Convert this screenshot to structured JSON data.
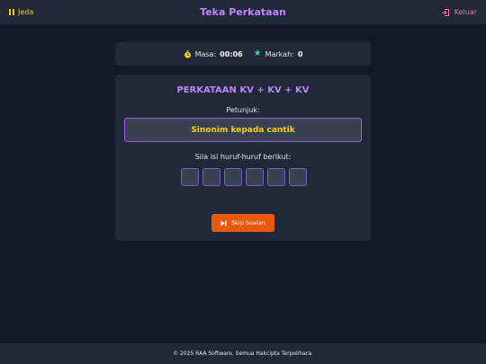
{
  "header": {
    "pause_label": "Jeda",
    "title": "Teka Perkataan",
    "exit_label": "Keluar"
  },
  "stats": {
    "time_label": "Masa:",
    "time_value": "00:06",
    "score_label": "Markah:",
    "score_value": "0"
  },
  "game": {
    "pattern": "PERKATAAN KV + KV + KV",
    "hint_label": "Petunjuk:",
    "hint_text": "Sinonim kepada cantik",
    "instruction": "Sila isi huruf-huruf berikut:",
    "letter_slots": [
      "",
      "",
      "",
      "",
      "",
      ""
    ],
    "skip_label": "Skip Soalan"
  },
  "footer": {
    "copyright": "© 2025 RAA Software. Semua Hakcipta Terpelihara."
  },
  "colors": {
    "background": "#121a2a",
    "panel": "#1f2937",
    "accent_purple": "#c084fc",
    "accent_yellow": "#facc15",
    "accent_pink": "#f472b6",
    "skip_orange": "#ea580c"
  }
}
